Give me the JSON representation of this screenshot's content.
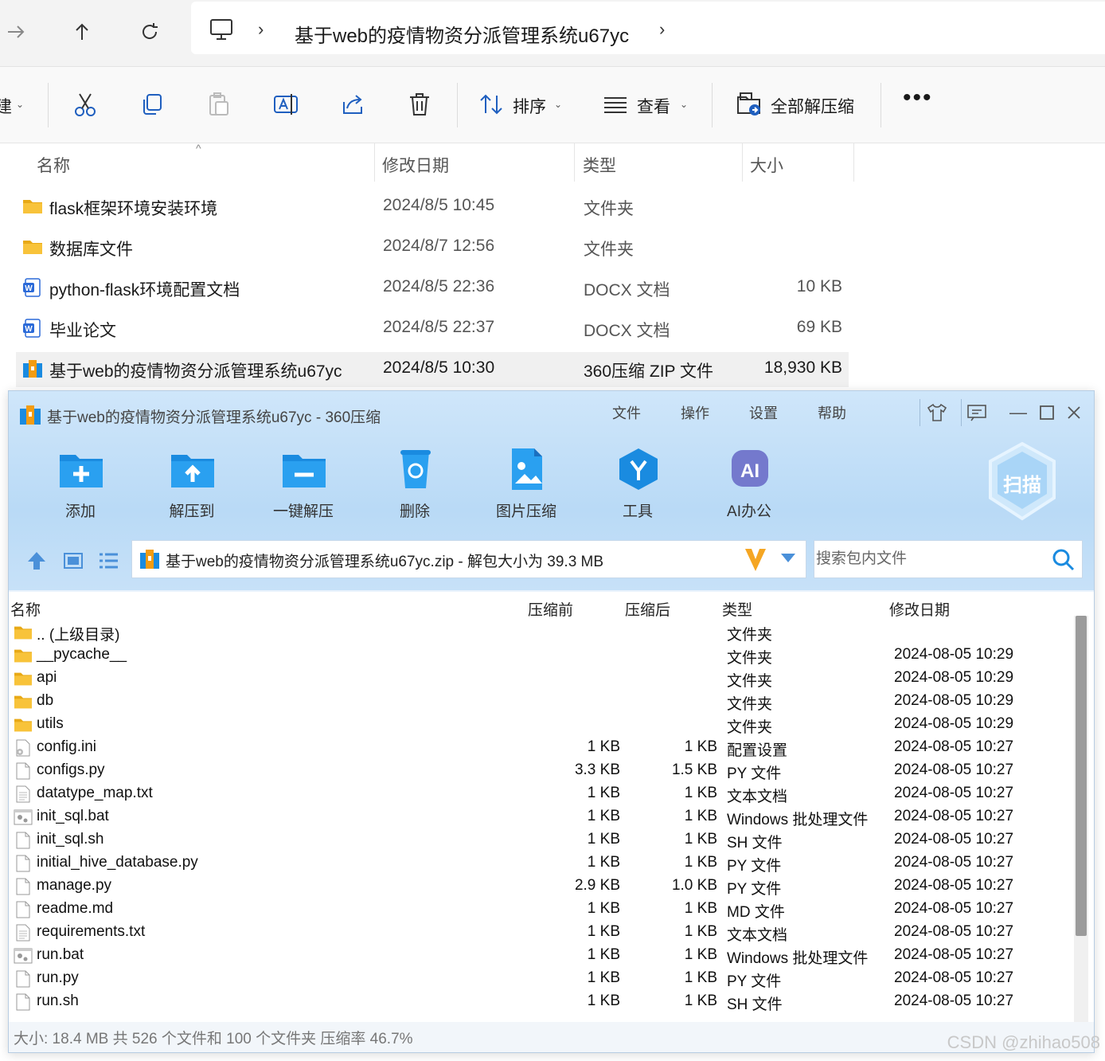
{
  "explorer": {
    "address": {
      "breadcrumb_folder": "基于web的疫情物资分派管理系统u67yc"
    },
    "commandbar": {
      "sort_label": "排序",
      "view_label": "查看",
      "extract_all_label": "全部解压缩"
    },
    "columns": {
      "name": "名称",
      "modified": "修改日期",
      "type": "类型",
      "size": "大小"
    },
    "rows": [
      {
        "name": "flask框架环境安装环境",
        "modified": "2024/8/5 10:45",
        "type": "文件夹",
        "size": "",
        "icon": "folder-icon"
      },
      {
        "name": "数据库文件",
        "modified": "2024/8/7 12:56",
        "type": "文件夹",
        "size": "",
        "icon": "folder-icon"
      },
      {
        "name": "python-flask环境配置文档",
        "modified": "2024/8/5 22:36",
        "type": "DOCX 文档",
        "size": "10 KB",
        "icon": "word-doc-icon"
      },
      {
        "name": "毕业论文",
        "modified": "2024/8/5 22:37",
        "type": "DOCX 文档",
        "size": "69 KB",
        "icon": "word-doc-icon"
      },
      {
        "name": "基于web的疫情物资分派管理系统u67yc",
        "modified": "2024/8/5 10:30",
        "type": "360压缩 ZIP 文件",
        "size": "18,930 KB",
        "icon": "zip-archive-icon"
      }
    ]
  },
  "zip": {
    "title": "基于web的疫情物资分派管理系统u67yc - 360压缩",
    "menu": [
      "文件",
      "操作",
      "设置",
      "帮助"
    ],
    "tools": [
      "添加",
      "解压到",
      "一键解压",
      "删除",
      "图片压缩",
      "工具",
      "AI办公"
    ],
    "scan_label": "扫描",
    "path_text": "基于web的疫情物资分派管理系统u67yc.zip - 解包大小为 39.3 MB",
    "search_placeholder": "搜索包内文件",
    "columns": {
      "name": "名称",
      "before": "压缩前",
      "after": "压缩后",
      "type": "类型",
      "modified": "修改日期"
    },
    "rows": [
      {
        "name": ".. (上级目录)",
        "before": "",
        "after": "",
        "type": "文件夹",
        "modified": "",
        "icon": "folder"
      },
      {
        "name": "__pycache__",
        "before": "",
        "after": "",
        "type": "文件夹",
        "modified": "2024-08-05 10:29",
        "icon": "folder"
      },
      {
        "name": "api",
        "before": "",
        "after": "",
        "type": "文件夹",
        "modified": "2024-08-05 10:29",
        "icon": "folder"
      },
      {
        "name": "db",
        "before": "",
        "after": "",
        "type": "文件夹",
        "modified": "2024-08-05 10:29",
        "icon": "folder"
      },
      {
        "name": "utils",
        "before": "",
        "after": "",
        "type": "文件夹",
        "modified": "2024-08-05 10:29",
        "icon": "folder"
      },
      {
        "name": "config.ini",
        "before": "1 KB",
        "after": "1 KB",
        "type": "配置设置",
        "modified": "2024-08-05 10:27",
        "icon": "ini"
      },
      {
        "name": "configs.py",
        "before": "3.3 KB",
        "after": "1.5 KB",
        "type": "PY 文件",
        "modified": "2024-08-05 10:27",
        "icon": "file"
      },
      {
        "name": "datatype_map.txt",
        "before": "1 KB",
        "after": "1 KB",
        "type": "文本文档",
        "modified": "2024-08-05 10:27",
        "icon": "text"
      },
      {
        "name": "init_sql.bat",
        "before": "1 KB",
        "after": "1 KB",
        "type": "Windows 批处理文件",
        "modified": "2024-08-05 10:27",
        "icon": "bat"
      },
      {
        "name": "init_sql.sh",
        "before": "1 KB",
        "after": "1 KB",
        "type": "SH 文件",
        "modified": "2024-08-05 10:27",
        "icon": "file"
      },
      {
        "name": "initial_hive_database.py",
        "before": "1 KB",
        "after": "1 KB",
        "type": "PY 文件",
        "modified": "2024-08-05 10:27",
        "icon": "file"
      },
      {
        "name": "manage.py",
        "before": "2.9 KB",
        "after": "1.0 KB",
        "type": "PY 文件",
        "modified": "2024-08-05 10:27",
        "icon": "file"
      },
      {
        "name": "readme.md",
        "before": "1 KB",
        "after": "1 KB",
        "type": "MD 文件",
        "modified": "2024-08-05 10:27",
        "icon": "file"
      },
      {
        "name": "requirements.txt",
        "before": "1 KB",
        "after": "1 KB",
        "type": "文本文档",
        "modified": "2024-08-05 10:27",
        "icon": "text"
      },
      {
        "name": "run.bat",
        "before": "1 KB",
        "after": "1 KB",
        "type": "Windows 批处理文件",
        "modified": "2024-08-05 10:27",
        "icon": "bat"
      },
      {
        "name": "run.py",
        "before": "1 KB",
        "after": "1 KB",
        "type": "PY 文件",
        "modified": "2024-08-05 10:27",
        "icon": "file"
      },
      {
        "name": "run.sh",
        "before": "1 KB",
        "after": "1 KB",
        "type": "SH 文件",
        "modified": "2024-08-05 10:27",
        "icon": "file"
      }
    ],
    "status": "大小: 18.4 MB 共 526 个文件和 100 个文件夹 压缩率 46.7%"
  },
  "watermark": "CSDN @zhihao508",
  "colors": {
    "folder": "#f8c33a",
    "word": "#2b6ad8",
    "zip_blue": "#1a8be0",
    "accent_orange": "#f39c12"
  }
}
